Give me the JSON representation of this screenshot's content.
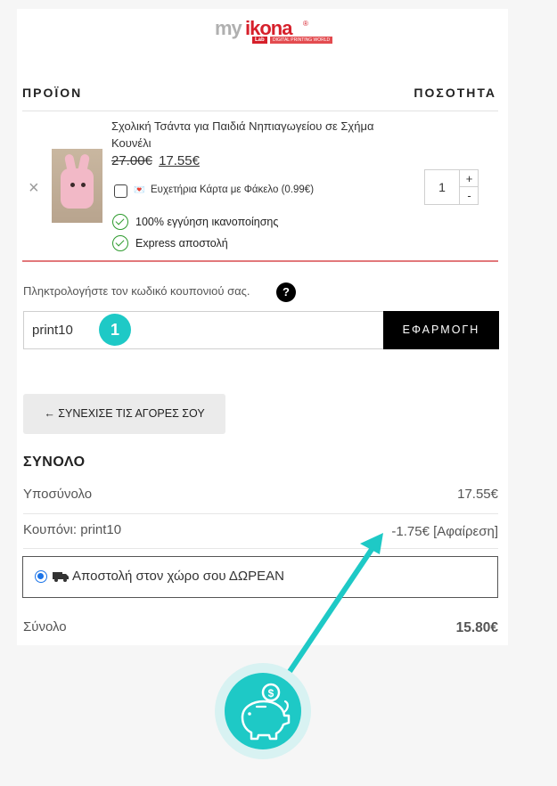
{
  "brand": {
    "logo_my": "my",
    "logo_ikona": "ikona",
    "logo_lab": "Lab",
    "logo_tagline": "DIGITAL PRINTING WORLD"
  },
  "cart": {
    "header_product": "ΠΡΟΪΟΝ",
    "header_quantity": "ΠΟΣΟΤΗΤΑ",
    "remove_icon": "×",
    "item": {
      "name": "Σχολική Τσάντα για Παιδιά Νηπιαγωγείου σε Σχήμα Κουνέλι",
      "price_old": "27.00€",
      "price_new": "17.55€",
      "addon_label": "Ευχετήρια Κάρτα με Φάκελο (0.99€)",
      "feature_1": "100% εγγύηση ικανοποίησης",
      "feature_2": "Express αποστολή",
      "quantity": "1",
      "qty_plus": "+",
      "qty_minus": "-"
    }
  },
  "coupon": {
    "prompt": "Πληκτρολογήστε τον κωδικό κουπονιού σας.",
    "help_icon": "?",
    "input_value": "print10",
    "step_number": "1",
    "apply_label": "ΕΦΑΡΜΟΓΗ"
  },
  "continue_label": "← ΣΥΝΕΧΙΣΕ ΤΙΣ ΑΓΟΡΕΣ ΣΟΥ",
  "totals": {
    "title": "ΣΥΝΟΛΟ",
    "subtotal_label": "Υποσύνολο",
    "subtotal_value": "17.55€",
    "coupon_label": "Κουπόνι: print10",
    "coupon_value": "-1.75€ [Αφαίρεση]",
    "shipping_label": "Αποστολή στον χώρο σου ΔΩΡΕΑΝ",
    "total_label": "Σύνολο",
    "total_value": "15.80€"
  },
  "colors": {
    "accent_teal": "#1ec9c6",
    "divider_red": "#e2787b",
    "button_black": "#000000",
    "success_green": "#2e9b2e"
  },
  "icons": {
    "remove": "close-icon",
    "help": "question-icon",
    "check": "check-circle-icon",
    "shipping": "truck-icon",
    "savings": "piggy-bank-icon"
  }
}
